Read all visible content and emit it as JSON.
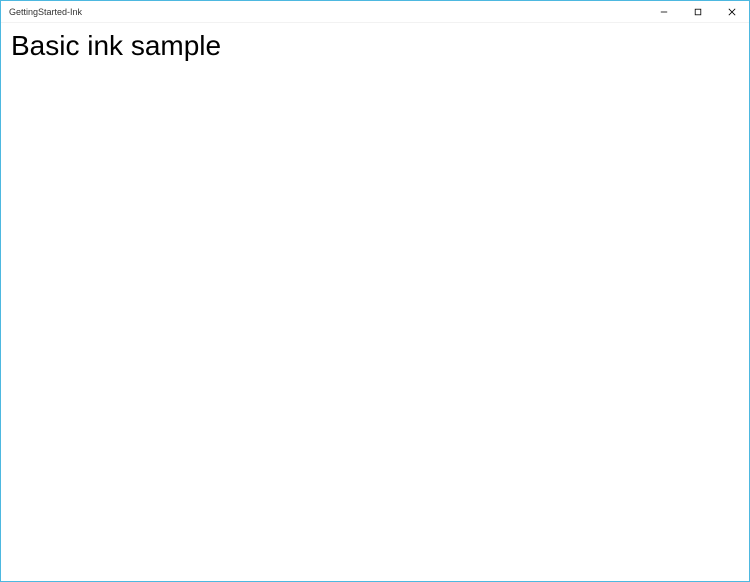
{
  "window": {
    "title": "GettingStarted-Ink"
  },
  "header": {
    "page_title": "Basic ink sample"
  }
}
